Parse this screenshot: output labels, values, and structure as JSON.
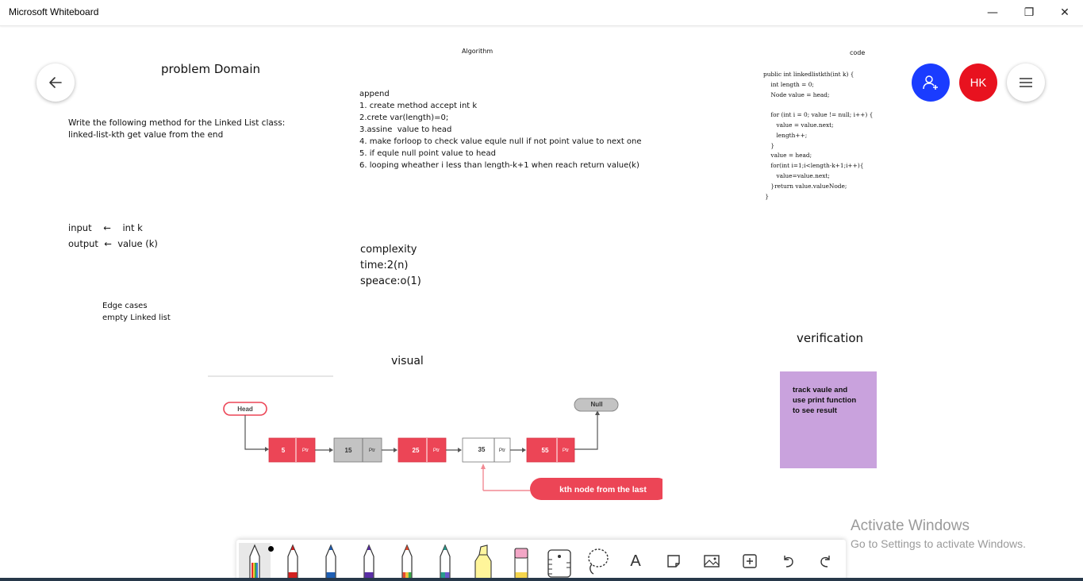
{
  "window": {
    "title": "Microsoft Whiteboard",
    "controls": {
      "minimize": "—",
      "maximize": "❐",
      "close": "✕"
    }
  },
  "board": {
    "problem_domain_heading": "problem Domain",
    "problem_text": "Write the following method for the Linked List class:\nlinked-list-kth get value from the end",
    "io_text": "input    ←    int k\noutput  ←  value (k)",
    "edge_cases_text": "Edge cases\nempty Linked list",
    "algorithm_heading": "Algorithm",
    "algorithm_text": "append\n1. create method accept int k\n2.crete var(length)=0;\n3.assine  value to head\n4. make forloop to check value equle null if not point value to next one\n5. if equle null point value to head\n6. looping wheather i less than length-k+1 when reach return value(k)",
    "complexity_text": "complexity\ntime:2(n)\nspeace:o(1)",
    "code_heading": "code",
    "code_text": "public int linkedlistkth(int k) {\n    int length = 0;\n    Node value = head;\n\n    for (int i = 0; value != null; i++) {\n       value = value.next;\n       length++;\n    }\n    value = head;\n    for(int i=1;i<length-k+1;i++){\n       value=value.next;\n    }return value.valueNode;\n }",
    "visual_heading": "visual",
    "verification_heading": "verification",
    "sticky_note_text": "track vaule and\nuse print function\nto see result"
  },
  "diagram": {
    "head_label": "Head",
    "null_label": "Null",
    "ptr_label": "Ptr",
    "nodes": [
      "5",
      "15",
      "25",
      "35",
      "55"
    ],
    "kth_label": "kth node from the last",
    "colors": {
      "red": "#ec4556",
      "gray": "#c3c3c3",
      "white": "#ffffff",
      "line": "#555555",
      "pink_line": "#f28a93"
    }
  },
  "buttons": {
    "avatar_initials": "HK"
  },
  "watermark": {
    "line1": "Activate Windows",
    "line2": "Go to Settings to activate Windows."
  },
  "colors": {
    "invite": "#1a3cff",
    "avatar": "#e8121f",
    "sticky": "#c9a2dd"
  },
  "toolbar": {
    "tools": [
      "rainbow-pen-icon",
      "red-pen-icon",
      "blue-pen-icon",
      "purple-pen-icon",
      "rainbow-marker-icon",
      "teal-pen-icon",
      "yellow-highlighter-icon",
      "pink-eraser-icon",
      "ruler-icon",
      "lasso-icon",
      "text-icon",
      "sticky-note-icon",
      "image-icon",
      "add-icon",
      "undo-icon",
      "redo-icon"
    ],
    "text_tool_label": "A"
  }
}
